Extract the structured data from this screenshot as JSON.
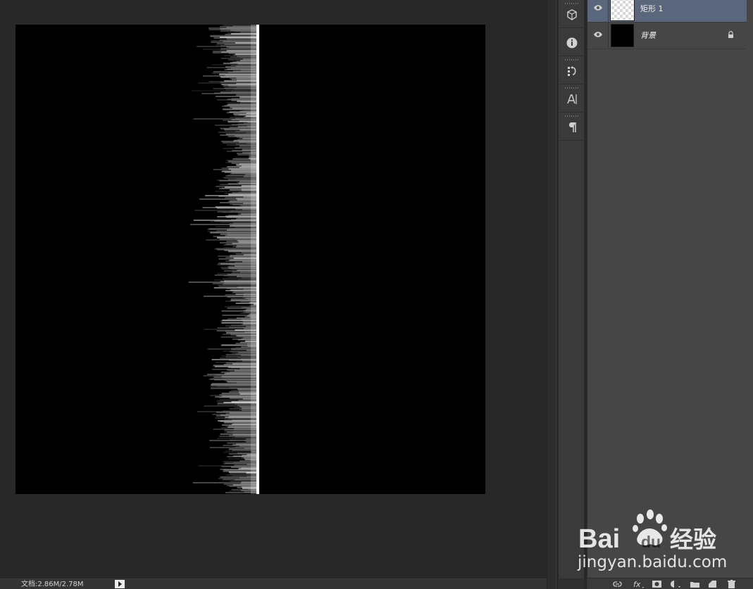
{
  "status_bar": {
    "document_info": "文档:2.86M/2.78M"
  },
  "layers": {
    "items": [
      {
        "name": "矩形 1",
        "selected": true,
        "thumbnail": "transparent-checkerboard",
        "visible": true,
        "locked": false
      },
      {
        "name": "背景",
        "selected": false,
        "thumbnail": "black",
        "visible": true,
        "locked": true
      }
    ]
  },
  "dock": {
    "icons": [
      "3d-cube-icon",
      "info-icon",
      "history-icon",
      "character-icon",
      "paragraph-icon"
    ]
  },
  "footer": {
    "icons": [
      "link-layers-icon",
      "fx-icon",
      "mask-icon",
      "adjustment-icon",
      "folder-icon",
      "new-layer-icon",
      "trash-icon"
    ]
  },
  "watermark": {
    "logo_text": "Bai 经验",
    "logo_text_parts": [
      "Bai",
      "du",
      "经验"
    ],
    "url": "jingyan.baidu.com"
  },
  "colors": {
    "workspace_bg": "#282828",
    "layers_panel_bg": "#464646",
    "selected_layer_bg": "#5a667b",
    "canvas_bg": "#000000",
    "streak_color": "#ffffff"
  }
}
